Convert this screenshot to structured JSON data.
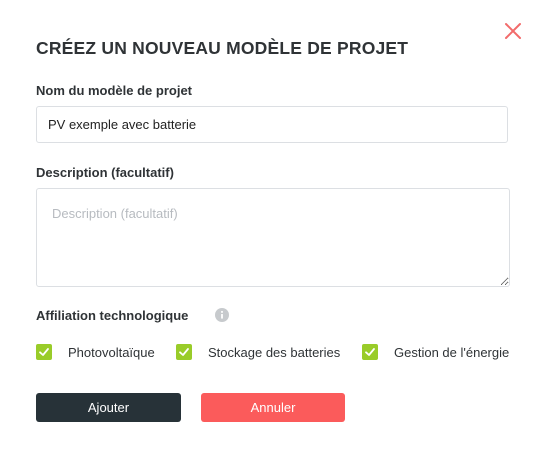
{
  "dialog": {
    "title": "CRÉEZ UN NOUVEAU MODÈLE DE PROJET",
    "close_icon": "close-icon"
  },
  "form": {
    "name_label": "Nom du modèle de projet",
    "name_value": "PV exemple avec batterie",
    "description_label": "Description (facultatif)",
    "description_placeholder": "Description (facultatif)",
    "description_value": "",
    "affiliation_label": "Affiliation technologique",
    "affiliation_info_icon": "info-icon",
    "technologies": [
      {
        "label": "Photovoltaïque",
        "checked": true
      },
      {
        "label": "Stockage des batteries",
        "checked": true
      },
      {
        "label": "Gestion de l'énergie",
        "checked": true
      }
    ]
  },
  "actions": {
    "add_label": "Ajouter",
    "cancel_label": "Annuler"
  },
  "colors": {
    "accent_green": "#99cc29",
    "primary_dark": "#273238",
    "danger": "#fb5b5b",
    "close": "#f26b6b"
  }
}
